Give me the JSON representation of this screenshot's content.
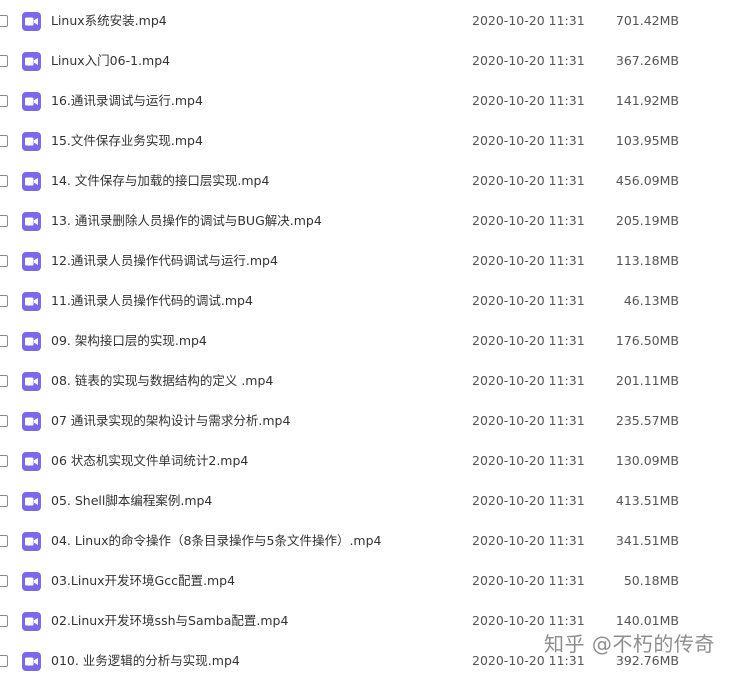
{
  "icon": "video-file-icon",
  "colors": {
    "icon_accent": "#7b68ee",
    "text": "#333333"
  },
  "files": [
    {
      "name": "Linux系统安装.mp4",
      "date": "2020-10-20 11:31",
      "size": "701.42MB"
    },
    {
      "name": "Linux入门06-1.mp4",
      "date": "2020-10-20 11:31",
      "size": "367.26MB"
    },
    {
      "name": "16.通讯录调试与运行.mp4",
      "date": "2020-10-20 11:31",
      "size": "141.92MB"
    },
    {
      "name": "15.文件保存业务实现.mp4",
      "date": "2020-10-20 11:31",
      "size": "103.95MB"
    },
    {
      "name": "14. 文件保存与加载的接口层实现.mp4",
      "date": "2020-10-20 11:31",
      "size": "456.09MB"
    },
    {
      "name": "13. 通讯录删除人员操作的调试与BUG解决.mp4",
      "date": "2020-10-20 11:31",
      "size": "205.19MB"
    },
    {
      "name": "12.通讯录人员操作代码调试与运行.mp4",
      "date": "2020-10-20 11:31",
      "size": "113.18MB"
    },
    {
      "name": "11.通讯录人员操作代码的调试.mp4",
      "date": "2020-10-20 11:31",
      "size": "46.13MB"
    },
    {
      "name": "09. 架构接口层的实现.mp4",
      "date": "2020-10-20 11:31",
      "size": "176.50MB"
    },
    {
      "name": "08. 链表的实现与数据结构的定义 .mp4",
      "date": "2020-10-20 11:31",
      "size": "201.11MB"
    },
    {
      "name": "07 通讯录实现的架构设计与需求分析.mp4",
      "date": "2020-10-20 11:31",
      "size": "235.57MB"
    },
    {
      "name": "06 状态机实现文件单词统计2.mp4",
      "date": "2020-10-20 11:31",
      "size": "130.09MB"
    },
    {
      "name": "05. Shell脚本编程案例.mp4",
      "date": "2020-10-20 11:31",
      "size": "413.51MB"
    },
    {
      "name": "04. Linux的命令操作（8条目录操作与5条文件操作）.mp4",
      "date": "2020-10-20 11:31",
      "size": "341.51MB"
    },
    {
      "name": "03.Linux开发环境Gcc配置.mp4",
      "date": "2020-10-20 11:31",
      "size": "50.18MB"
    },
    {
      "name": "02.Linux开发环境ssh与Samba配置.mp4",
      "date": "2020-10-20 11:31",
      "size": "140.01MB"
    },
    {
      "name": "010. 业务逻辑的分析与实现.mp4",
      "date": "2020-10-20 11:31",
      "size": "392.76MB"
    }
  ],
  "watermark": "知乎 @不朽的传奇"
}
